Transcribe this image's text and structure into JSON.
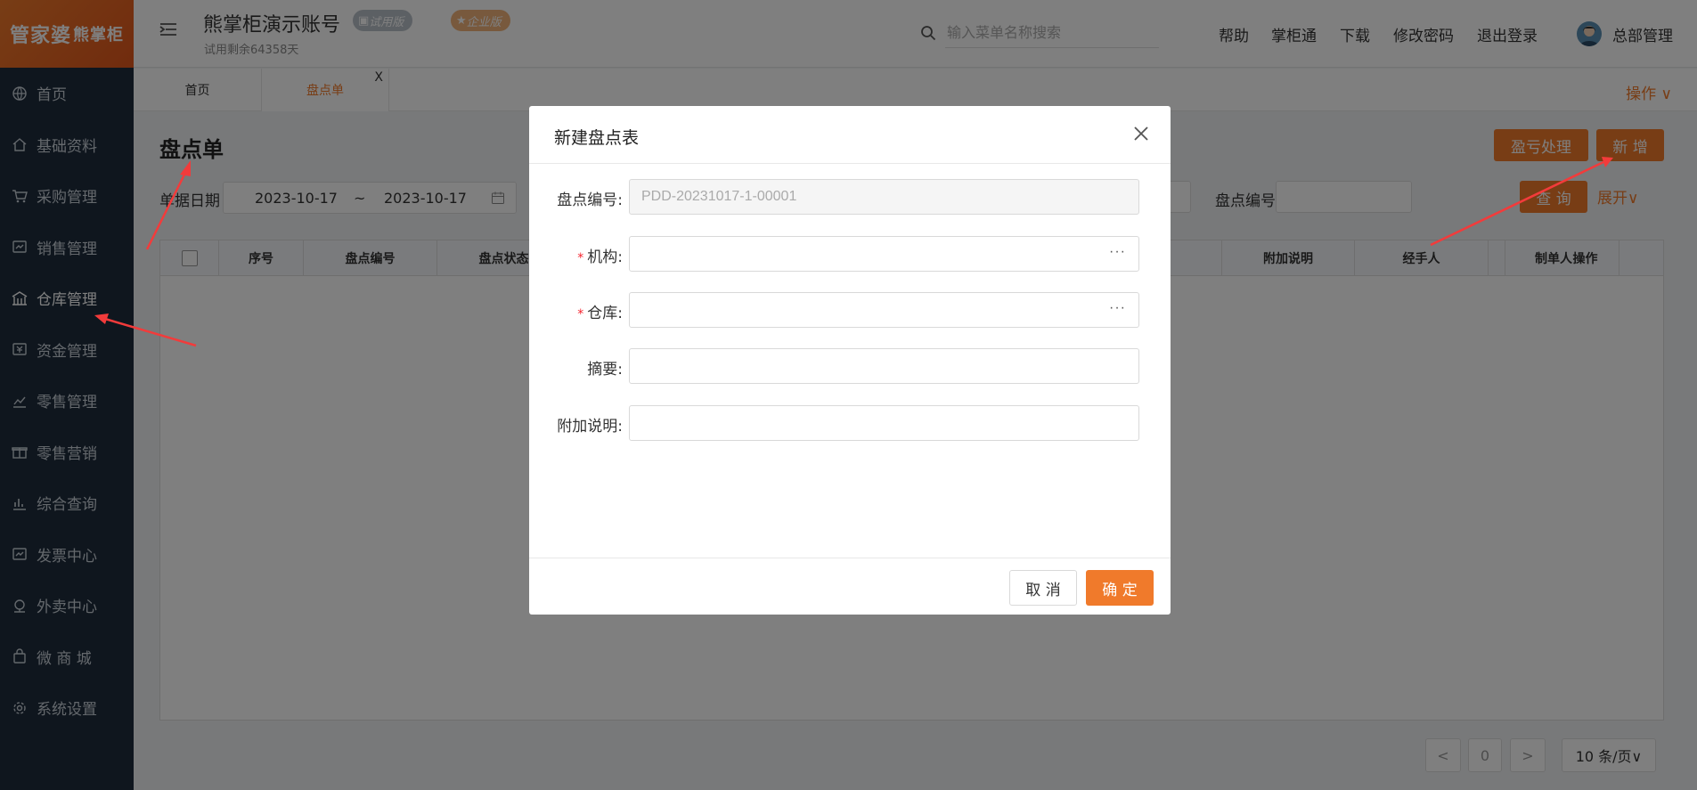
{
  "logo": {
    "main": "管家婆",
    "sub": "熊掌柜"
  },
  "sidebar": {
    "items": [
      {
        "label": "首页",
        "icon": "globe-icon"
      },
      {
        "label": "基础资料",
        "icon": "home-icon"
      },
      {
        "label": "采购管理",
        "icon": "cart-icon"
      },
      {
        "label": "销售管理",
        "icon": "sales-icon"
      },
      {
        "label": "仓库管理",
        "icon": "warehouse-icon"
      },
      {
        "label": "资金管理",
        "icon": "money-icon"
      },
      {
        "label": "零售管理",
        "icon": "chart-icon"
      },
      {
        "label": "零售营销",
        "icon": "gift-icon"
      },
      {
        "label": "综合查询",
        "icon": "bar-chart-icon"
      },
      {
        "label": "发票中心",
        "icon": "invoice-icon"
      },
      {
        "label": "外卖中心",
        "icon": "delivery-icon"
      },
      {
        "label": "微 商 城",
        "icon": "shop-icon"
      },
      {
        "label": "系统设置",
        "icon": "gear-icon"
      }
    ]
  },
  "header": {
    "account_title": "熊掌柜演示账号",
    "badge_trial": "试用版",
    "badge_enterprise": "企业版",
    "trial_remaining": "试用剩余64358天",
    "search_placeholder": "输入菜单名称搜索",
    "links": [
      "帮助",
      "掌柜通",
      "下载",
      "修改密码",
      "退出登录"
    ],
    "user_name": "总部管理"
  },
  "tabs": {
    "home": "首页",
    "current": "盘点单",
    "close": "X",
    "ops": "操作 ∨"
  },
  "page": {
    "title": "盘点单",
    "date_label": "单据日期",
    "date_from": "2023-10-17",
    "date_sep": "~",
    "date_to": "2023-10-17",
    "code_label": "盘点编号",
    "btn_loss": "盈亏处理",
    "btn_new": "新 增",
    "btn_query": "查 询",
    "expand": "展开∨",
    "columns": [
      "序号",
      "盘点编号",
      "盘点状态",
      "附加说明",
      "经手人",
      "制单人",
      "操作"
    ],
    "pager_page": "0",
    "pager_size": "10 条/页∨"
  },
  "modal": {
    "title": "新建盘点表",
    "fields": [
      {
        "label": "盘点编号:",
        "required": false,
        "value": "PDD-20231017-1-00001",
        "disabled": true,
        "dots": false
      },
      {
        "label": "机构:",
        "required": true,
        "value": "",
        "disabled": false,
        "dots": true
      },
      {
        "label": "仓库:",
        "required": true,
        "value": "",
        "disabled": false,
        "dots": true
      },
      {
        "label": "摘要:",
        "required": false,
        "value": "",
        "disabled": false,
        "dots": false
      },
      {
        "label": "附加说明:",
        "required": false,
        "value": "",
        "disabled": false,
        "dots": false
      }
    ],
    "cancel": "取 消",
    "ok": "确 定",
    "required_mark": "*",
    "dots": "···"
  },
  "colors": {
    "accent": "#f07a2b",
    "sidebar_bg": "#1f2d3d",
    "annotation_arrow": "#f23b3b"
  }
}
